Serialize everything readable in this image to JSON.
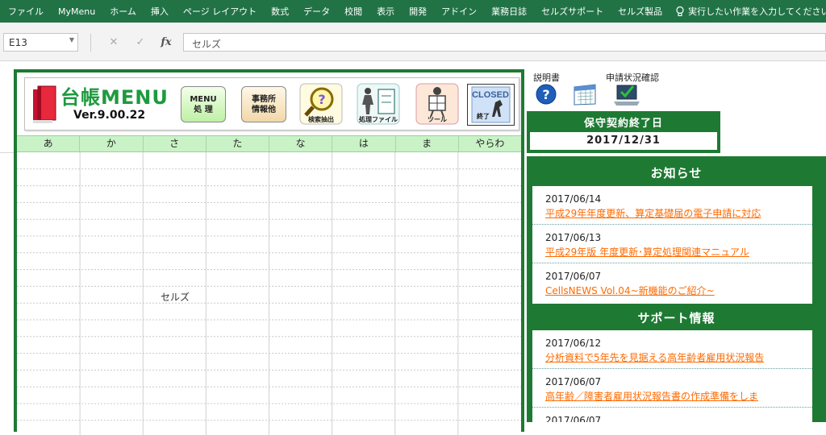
{
  "ribbon": {
    "tabs": [
      "ファイル",
      "MyMenu",
      "ホーム",
      "挿入",
      "ページ レイアウト",
      "数式",
      "データ",
      "校閲",
      "表示",
      "開発",
      "アドイン",
      "業務日誌",
      "セルズサポート",
      "セルズ製品"
    ],
    "tell_me": "実行したい作業を入力してください"
  },
  "formula_bar": {
    "name_box": "E13",
    "cancel_icon": "✕",
    "enter_icon": "✓",
    "fx_label": "fx",
    "formula": "セルズ"
  },
  "menu_panel": {
    "logo_title": "台帳MENU",
    "version": "Ver.9.00.22",
    "btn_menu": [
      "MENU",
      "処 理"
    ],
    "btn_office": [
      "事務所",
      "情報他"
    ],
    "btn_search": "検索抽出",
    "btn_file": "処理ファイル",
    "btn_tool": "ツール",
    "btn_closed": "CLOSED",
    "btn_closed_sub": "終了",
    "kana_tabs": [
      "あ",
      "か",
      "さ",
      "た",
      "な",
      "は",
      "ま",
      "やらわ"
    ],
    "grid_cell_text": "セルズ"
  },
  "top_icons": {
    "manual": "説明書",
    "status": "申請状況確認"
  },
  "maintenance": {
    "title": "保守契約終了日",
    "date": "2017/12/31"
  },
  "news": {
    "title": "お知らせ",
    "items": [
      {
        "date": "2017/06/14",
        "text": "平成29年年度更新、算定基礎届の電子申請に対応"
      },
      {
        "date": "2017/06/13",
        "text": "平成29年版 年度更新･算定処理関連マニュアル"
      },
      {
        "date": "2017/06/07",
        "text": "CellsNEWS Vol.04~新機能のご紹介~"
      }
    ]
  },
  "support": {
    "title": "サポート情報",
    "items": [
      {
        "date": "2017/06/12",
        "text": "分析資料で5年先を見据える高年齢者雇用状況報告"
      },
      {
        "date": "2017/06/07",
        "text": "高年齢／障害者雇用状況報告書の作成準備をしま"
      },
      {
        "date": "2017/06/07",
        "text": ""
      }
    ]
  },
  "colors": {
    "ribbon": "#217346",
    "panel_green": "#1e7a33",
    "kana_header": "#c9f2c6",
    "link_orange": "#ff6a00"
  }
}
